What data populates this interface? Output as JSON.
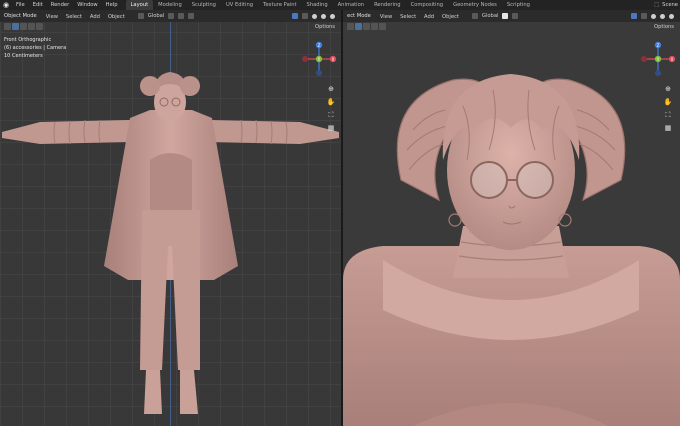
{
  "menu": {
    "file": "File",
    "edit": "Edit",
    "render": "Render",
    "window": "Window",
    "help": "Help"
  },
  "tabs": [
    "Layout",
    "Modeling",
    "Sculpting",
    "UV Editing",
    "Texture Paint",
    "Shading",
    "Animation",
    "Rendering",
    "Compositing",
    "Geometry Nodes",
    "Scripting"
  ],
  "active_tab_index": 0,
  "scene_label": "Scene",
  "left_viewport": {
    "mode": "Object Mode",
    "menus": [
      "View",
      "Select",
      "Add",
      "Object"
    ],
    "transform": "Global",
    "options": "Options",
    "info": [
      "Front Orthographic",
      "(6) accessories | Camera",
      "10 Centimeters"
    ]
  },
  "right_viewport": {
    "mode": "ect Mode",
    "menus": [
      "View",
      "Select",
      "Add",
      "Object"
    ],
    "transform": "Global",
    "options": "Options"
  },
  "gizmo": {
    "z": "Z",
    "x": "X",
    "y": "Y"
  },
  "colors": {
    "x_axis": "#e04b5b",
    "y_axis": "#7fbf3a",
    "z_axis": "#3f7fe3",
    "model": "#c69a92",
    "active_tab": "#3b3b3b"
  },
  "nav_icons": [
    "zoom-icon",
    "pan-hand-icon",
    "camera-icon",
    "grid-icon"
  ]
}
